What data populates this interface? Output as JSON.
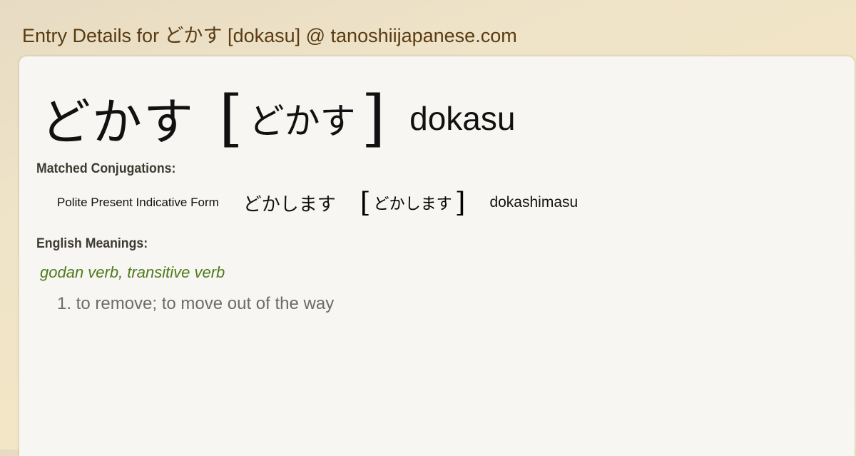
{
  "page": {
    "title": "Entry Details for どかす [dokasu] @ tanoshiijapanese.com"
  },
  "entry": {
    "kanji": "どかす",
    "reading_open_bracket": "[",
    "reading": "どかす",
    "reading_close_bracket": "]",
    "romaji": "dokasu"
  },
  "conjugations": {
    "label": "Matched Conjugations:",
    "items": [
      {
        "form_name": "Polite Present Indicative Form",
        "kanji": "どかします",
        "open_bracket": "[",
        "reading": "どかします",
        "close_bracket": "]",
        "romaji": "dokashimasu"
      }
    ]
  },
  "meanings": {
    "label": "English Meanings:",
    "part_of_speech": "godan verb, transitive verb",
    "definitions": [
      "1. to remove; to move out of the way"
    ]
  },
  "colors": {
    "header_text": "#5a3b12",
    "card_background": "#f7f6f2",
    "part_of_speech": "#4e7a1e",
    "definition_text": "#6b6b6b",
    "section_label": "#3d3a30"
  }
}
